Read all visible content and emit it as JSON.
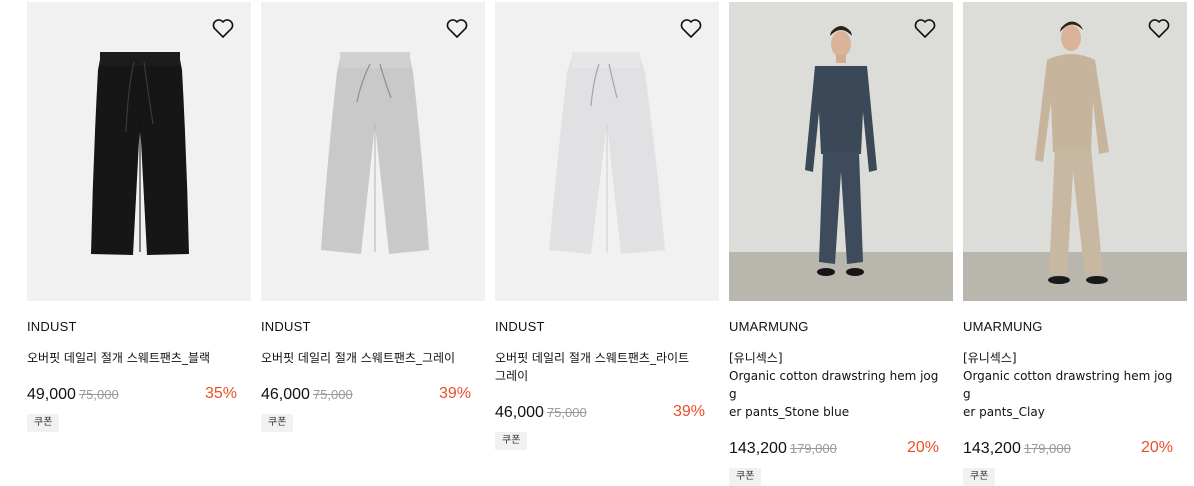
{
  "colors": {
    "discount": "#e8502a",
    "strike": "#9a9a9a",
    "coupon_bg": "#f1f1f1"
  },
  "products": [
    {
      "brand": "INDUST",
      "name_lines": [
        "오버핏 데일리 절개 스웨트팬츠_블랙"
      ],
      "price": "49,000",
      "original_price": "75,000",
      "discount": "35%",
      "coupon": "쿠폰",
      "image": "black-sweatpants-flatlay",
      "wishlist_icon": "heart-outline-icon"
    },
    {
      "brand": "INDUST",
      "name_lines": [
        "오버핏 데일리 절개 스웨트팬츠_그레이"
      ],
      "price": "46,000",
      "original_price": "75,000",
      "discount": "39%",
      "coupon": "쿠폰",
      "image": "grey-sweatpants-flatlay",
      "wishlist_icon": "heart-outline-icon"
    },
    {
      "brand": "INDUST",
      "name_lines": [
        "오버핏 데일리 절개 스웨트팬츠_라이트",
        "그레이"
      ],
      "price": "46,000",
      "original_price": "75,000",
      "discount": "39%",
      "coupon": "쿠폰",
      "image": "light-grey-sweatpants-flatlay",
      "wishlist_icon": "heart-outline-icon"
    },
    {
      "brand": "UMARMUNG",
      "name_lines": [
        "[유니섹스]",
        "Organic cotton drawstring hem jogg",
        "er pants_Stone blue"
      ],
      "price": "143,200",
      "original_price": "179,000",
      "discount": "20%",
      "coupon": "쿠폰",
      "image": "model-stone-blue-set",
      "wishlist_icon": "heart-outline-icon"
    },
    {
      "brand": "UMARMUNG",
      "name_lines": [
        "[유니섹스]",
        "Organic cotton drawstring hem jogg",
        "er pants_Clay"
      ],
      "price": "143,200",
      "original_price": "179,000",
      "discount": "20%",
      "coupon": "쿠폰",
      "image": "model-clay-set",
      "wishlist_icon": "heart-outline-icon"
    }
  ]
}
